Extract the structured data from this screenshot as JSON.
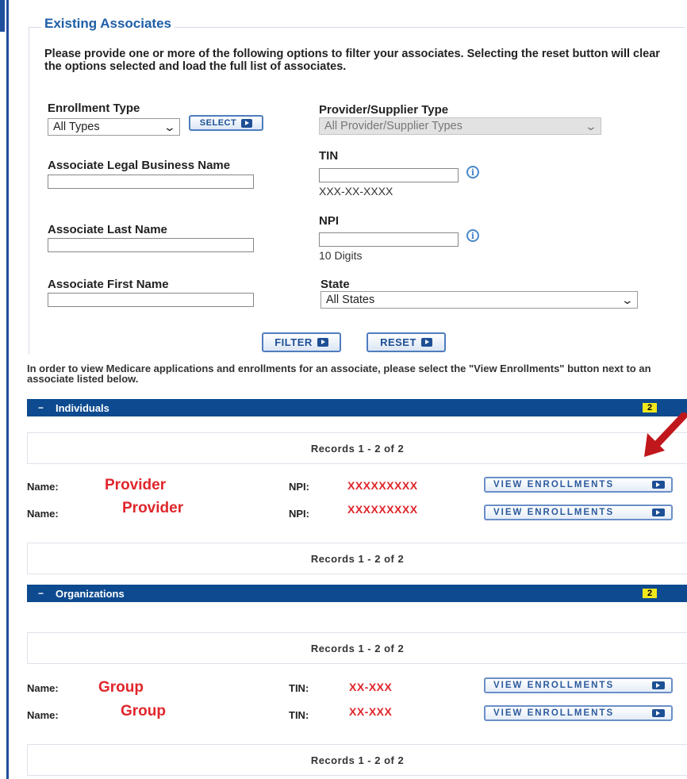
{
  "section_title": "Existing Associates",
  "intro_text": "Please provide one or more of the following options to filter your associates. Selecting the reset button will clear the options selected and load the full list of associates.",
  "filters": {
    "enrollment_type": {
      "label": "Enrollment Type",
      "value": "All Types",
      "select_button": "SELECT"
    },
    "provider_supplier_type": {
      "label": "Provider/Supplier Type",
      "value": "All Provider/Supplier Types"
    },
    "legal_business_name": {
      "label": "Associate Legal Business Name",
      "value": ""
    },
    "tin": {
      "label": "TIN",
      "value": "",
      "hint": "XXX-XX-XXXX"
    },
    "last_name": {
      "label": "Associate Last Name",
      "value": ""
    },
    "npi": {
      "label": "NPI",
      "value": "",
      "hint": "10 Digits"
    },
    "first_name": {
      "label": "Associate First Name",
      "value": ""
    },
    "state": {
      "label": "State",
      "value": "All States"
    }
  },
  "buttons": {
    "filter": "FILTER",
    "reset": "RESET"
  },
  "view_note": "In order to view Medicare applications and enrollments for an associate, please select the \"View Enrollments\" button next to an associate listed below.",
  "individuals": {
    "header": "Individuals",
    "count": "2",
    "records_top": "Records 1 - 2 of 2",
    "records_bottom": "Records 1 - 2 of 2",
    "rows": [
      {
        "name_label": "Name:",
        "name": "Provider",
        "id_label": "NPI:",
        "id": "XXXXXXXXX",
        "action": "VIEW ENROLLMENTS"
      },
      {
        "name_label": "Name:",
        "name": "Provider",
        "id_label": "NPI:",
        "id": "XXXXXXXXX",
        "action": "VIEW ENROLLMENTS"
      }
    ]
  },
  "organizations": {
    "header": "Organizations",
    "count": "2",
    "records_top": "Records 1 - 2 of 2",
    "records_bottom": "Records 1 - 2 of 2",
    "rows": [
      {
        "name_label": "Name:",
        "name": "Group",
        "id_label": "TIN:",
        "id": "XX-XXX",
        "action": "VIEW ENROLLMENTS"
      },
      {
        "name_label": "Name:",
        "name": "Group",
        "id_label": "TIN:",
        "id": "XX-XXX",
        "action": "VIEW ENROLLMENTS"
      }
    ]
  },
  "colors": {
    "header_bar": "#0d4a8f",
    "title": "#1d5fa7",
    "annotation": "#e0262b",
    "badge": "#f2e71c"
  }
}
